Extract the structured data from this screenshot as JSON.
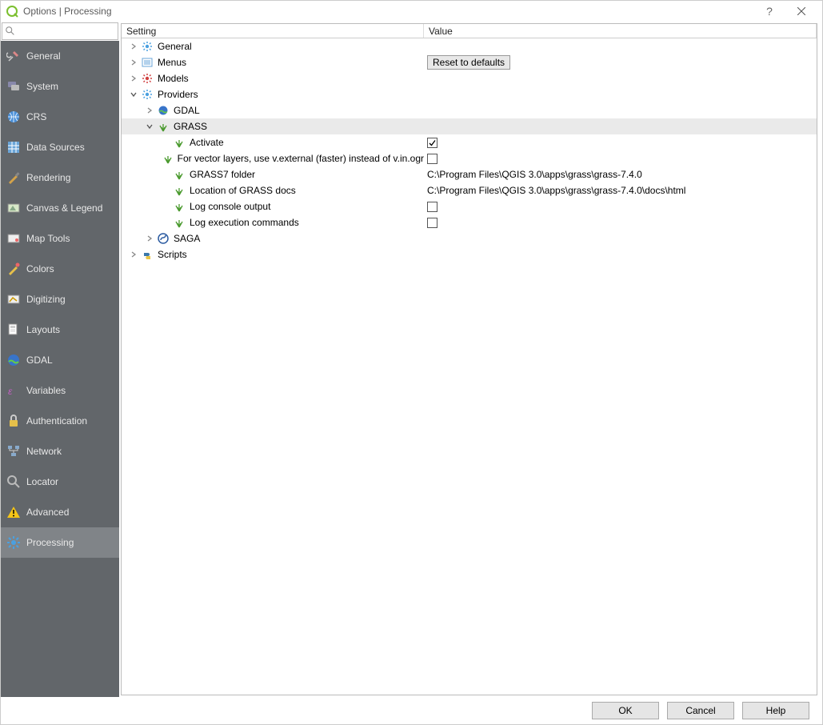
{
  "window": {
    "title": "Options | Processing"
  },
  "search": {
    "placeholder": ""
  },
  "sidebar": {
    "items": [
      {
        "label": "General",
        "icon": "tools"
      },
      {
        "label": "System",
        "icon": "system"
      },
      {
        "label": "CRS",
        "icon": "globe"
      },
      {
        "label": "Data Sources",
        "icon": "datasources"
      },
      {
        "label": "Rendering",
        "icon": "brush"
      },
      {
        "label": "Canvas & Legend",
        "icon": "canvas"
      },
      {
        "label": "Map Tools",
        "icon": "maptools"
      },
      {
        "label": "Colors",
        "icon": "colors"
      },
      {
        "label": "Digitizing",
        "icon": "digitizing"
      },
      {
        "label": "Layouts",
        "icon": "layouts"
      },
      {
        "label": "GDAL",
        "icon": "gdal"
      },
      {
        "label": "Variables",
        "icon": "variables"
      },
      {
        "label": "Authentication",
        "icon": "lock"
      },
      {
        "label": "Network",
        "icon": "network"
      },
      {
        "label": "Locator",
        "icon": "search"
      },
      {
        "label": "Advanced",
        "icon": "warning"
      },
      {
        "label": "Processing",
        "icon": "gear",
        "selected": true
      }
    ]
  },
  "columns": {
    "setting": "Setting",
    "value": "Value"
  },
  "tree": {
    "general": {
      "label": "General",
      "icon": "gear-blue"
    },
    "menus": {
      "label": "Menus",
      "icon": "menu-list",
      "reset_label": "Reset to defaults"
    },
    "models": {
      "label": "Models",
      "icon": "gear-red"
    },
    "providers": {
      "label": "Providers",
      "icon": "gear-blue",
      "gdal": {
        "label": "GDAL",
        "icon": "gdal"
      },
      "grass": {
        "label": "GRASS",
        "icon": "grass",
        "items": [
          {
            "label": "Activate",
            "type": "check",
            "checked": true
          },
          {
            "label": "For vector layers, use v.external (faster) instead of v.in.ogr",
            "type": "check",
            "checked": false
          },
          {
            "label": "GRASS7 folder",
            "type": "text",
            "value": "C:\\Program Files\\QGIS 3.0\\apps\\grass\\grass-7.4.0"
          },
          {
            "label": "Location of GRASS docs",
            "type": "text",
            "value": "C:\\Program Files\\QGIS 3.0\\apps\\grass\\grass-7.4.0\\docs\\html"
          },
          {
            "label": "Log console output",
            "type": "check",
            "checked": false
          },
          {
            "label": "Log execution commands",
            "type": "check",
            "checked": false
          }
        ]
      },
      "saga": {
        "label": "SAGA",
        "icon": "saga"
      }
    },
    "scripts": {
      "label": "Scripts",
      "icon": "python"
    }
  },
  "footer": {
    "ok": "OK",
    "cancel": "Cancel",
    "help": "Help"
  }
}
